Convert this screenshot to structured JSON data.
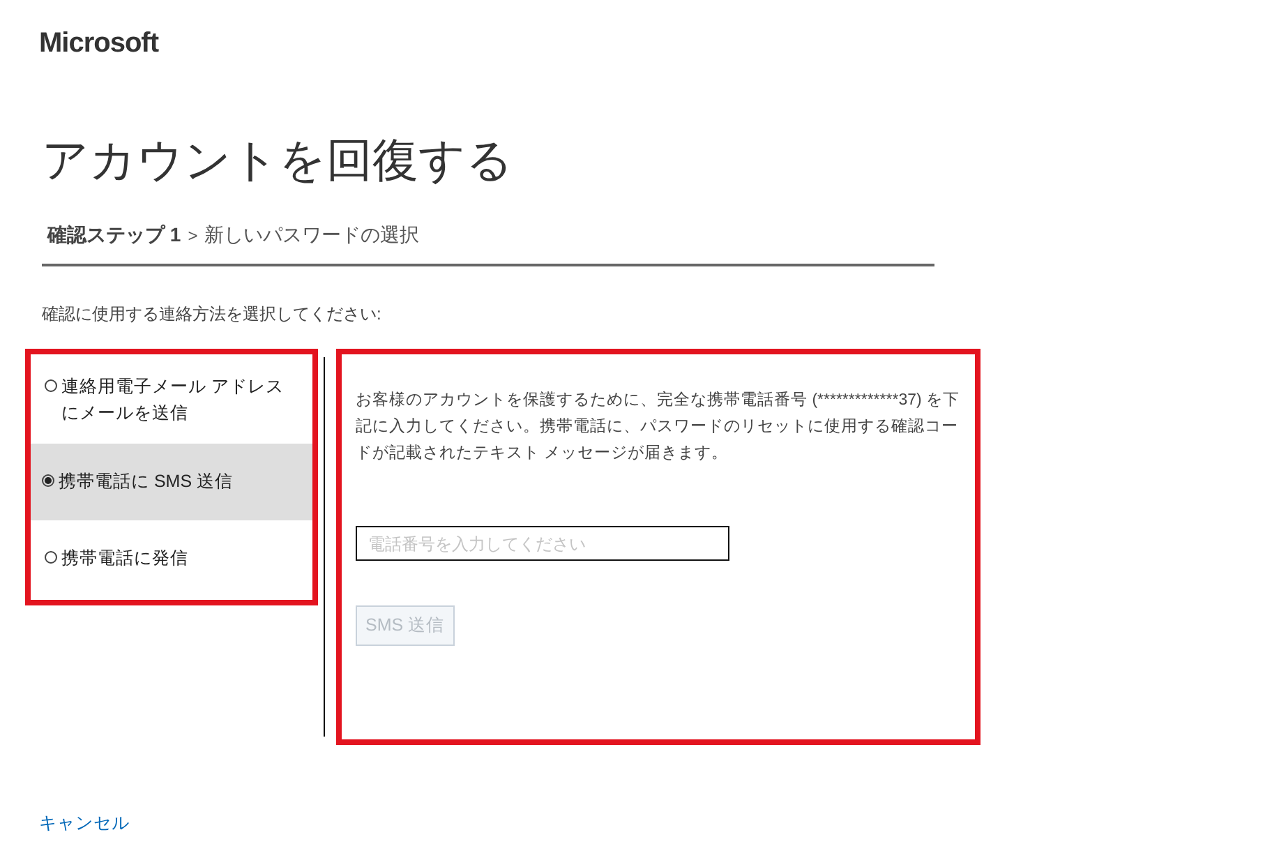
{
  "logo": "Microsoft",
  "title": "アカウントを回復する",
  "breadcrumb": {
    "separator": ">",
    "steps": [
      {
        "label": "確認ステップ 1",
        "current": true
      },
      {
        "label": "新しいパスワードの選択",
        "current": false
      }
    ]
  },
  "instruction": "確認に使用する連絡方法を選択してください:",
  "options": [
    {
      "label": "連絡用電子メール アドレスにメールを送信",
      "selected": false
    },
    {
      "label": "携帯電話に SMS 送信",
      "selected": true
    },
    {
      "label": "携帯電話に発信",
      "selected": false
    }
  ],
  "detail": {
    "message": "お客様のアカウントを保護するために、完全な携帯電話番号 (*************37) を下記に入力してください。携帯電話に、パスワードのリセットに使用する確認コードが記載されたテキスト メッセージが届きます。",
    "phone_field": {
      "placeholder": "電話番号を入力してください"
    },
    "send_button": {
      "label": "SMS 送信",
      "disabled": true
    }
  },
  "cancel_link": "キャンセル"
}
